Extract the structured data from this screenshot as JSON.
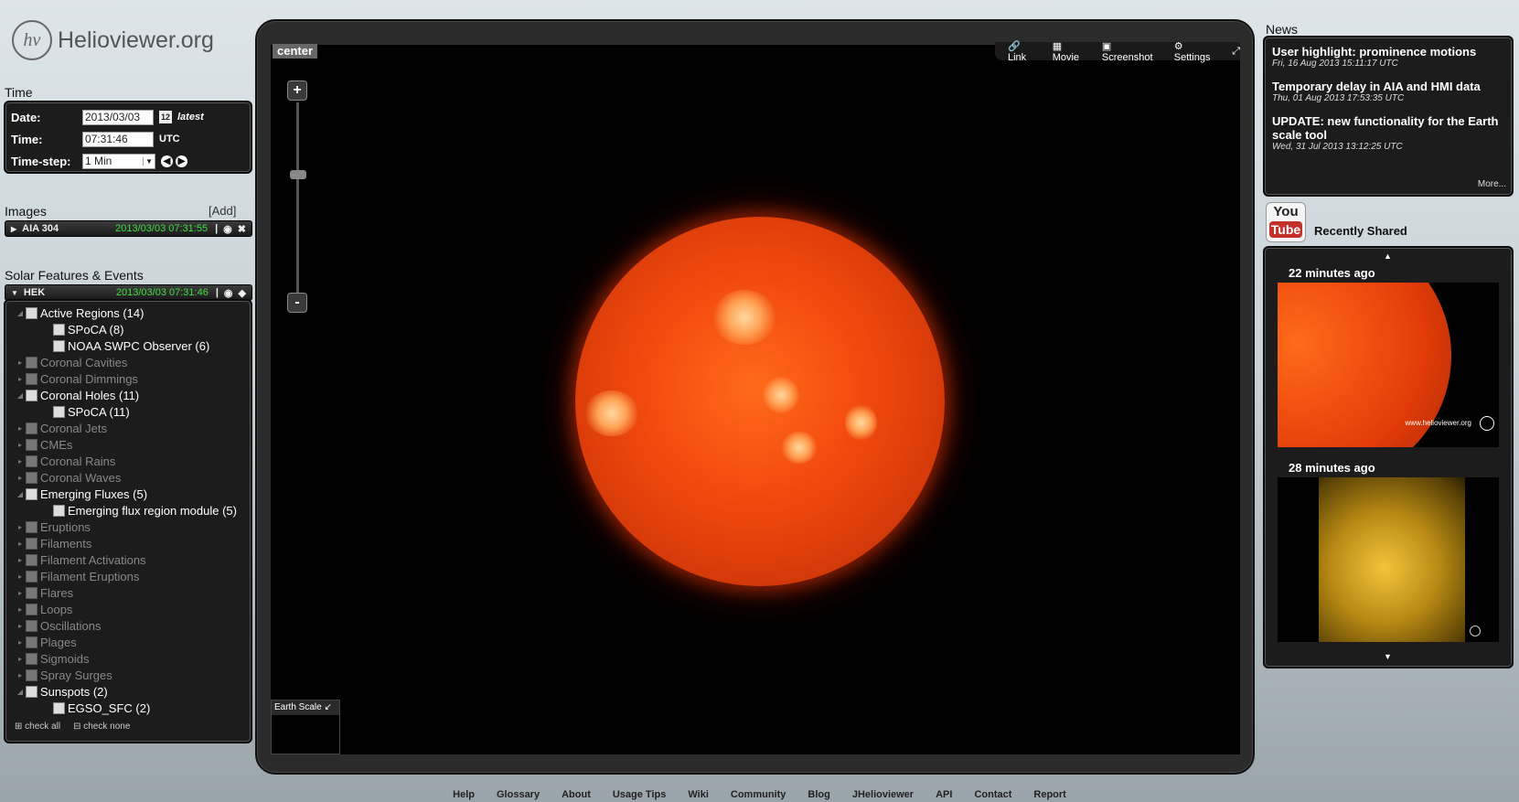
{
  "logo": {
    "mark": "hv",
    "name": "Helioviewer.org"
  },
  "time": {
    "section": "Time",
    "date_label": "Date:",
    "date_value": "2013/03/03",
    "calendar": "12",
    "latest": "latest",
    "time_label": "Time:",
    "time_value": "07:31:46",
    "utc": "UTC",
    "step_label": "Time-step:",
    "step_value": "1 Min"
  },
  "images": {
    "section": "Images",
    "add": "[Add]",
    "layer_name": "AIA 304",
    "layer_time": "2013/03/03 07:31:55"
  },
  "features": {
    "section": "Solar Features & Events",
    "hek_name": "HEK",
    "hek_time": "2013/03/03 07:31:46",
    "items": [
      {
        "label": "Active Regions (14)",
        "enabled": true,
        "level": 0,
        "expand": true
      },
      {
        "label": "SPoCA (8)",
        "enabled": true,
        "level": 1
      },
      {
        "label": "NOAA SWPC Observer (6)",
        "enabled": true,
        "level": 1
      },
      {
        "label": "Coronal Cavities",
        "enabled": false,
        "level": 0
      },
      {
        "label": "Coronal Dimmings",
        "enabled": false,
        "level": 0
      },
      {
        "label": "Coronal Holes (11)",
        "enabled": true,
        "level": 0,
        "expand": true
      },
      {
        "label": "SPoCA (11)",
        "enabled": true,
        "level": 1
      },
      {
        "label": "Coronal Jets",
        "enabled": false,
        "level": 0
      },
      {
        "label": "CMEs",
        "enabled": false,
        "level": 0
      },
      {
        "label": "Coronal Rains",
        "enabled": false,
        "level": 0
      },
      {
        "label": "Coronal Waves",
        "enabled": false,
        "level": 0
      },
      {
        "label": "Emerging Fluxes (5)",
        "enabled": true,
        "level": 0,
        "expand": true
      },
      {
        "label": "Emerging flux region module (5)",
        "enabled": true,
        "level": 1
      },
      {
        "label": "Eruptions",
        "enabled": false,
        "level": 0
      },
      {
        "label": "Filaments",
        "enabled": false,
        "level": 0
      },
      {
        "label": "Filament Activations",
        "enabled": false,
        "level": 0
      },
      {
        "label": "Filament Eruptions",
        "enabled": false,
        "level": 0
      },
      {
        "label": "Flares",
        "enabled": false,
        "level": 0
      },
      {
        "label": "Loops",
        "enabled": false,
        "level": 0
      },
      {
        "label": "Oscillations",
        "enabled": false,
        "level": 0
      },
      {
        "label": "Plages",
        "enabled": false,
        "level": 0
      },
      {
        "label": "Sigmoids",
        "enabled": false,
        "level": 0
      },
      {
        "label": "Spray Surges",
        "enabled": false,
        "level": 0
      },
      {
        "label": "Sunspots (2)",
        "enabled": true,
        "level": 0,
        "expand": true
      },
      {
        "label": "EGSO_SFC (2)",
        "enabled": true,
        "level": 1
      }
    ],
    "check_all": "check all",
    "check_none": "check none"
  },
  "viewport": {
    "center": "center",
    "toolbar": {
      "link": "Link",
      "movie": "Movie",
      "screenshot": "Screenshot",
      "settings": "Settings"
    },
    "earth_scale": "Earth Scale"
  },
  "news": {
    "section": "News",
    "items": [
      {
        "title": "User highlight: prominence motions",
        "date": "Fri, 16 Aug 2013 15:11:17 UTC"
      },
      {
        "title": "Temporary delay in AIA and HMI data",
        "date": "Thu, 01 Aug 2013 17:53:35 UTC"
      },
      {
        "title": "UPDATE: new functionality for the Earth scale tool",
        "date": "Wed, 31 Jul 2013 13:12:25 UTC"
      }
    ],
    "more": "More..."
  },
  "shared": {
    "youtube_top": "You",
    "youtube_bottom": "Tube",
    "title": "Recently Shared",
    "items": [
      {
        "time": "22 minutes ago",
        "watermark": "www.helioviewer.org"
      },
      {
        "time": "28 minutes ago"
      }
    ]
  },
  "footer": [
    "Help",
    "Glossary",
    "About",
    "Usage Tips",
    "Wiki",
    "Community",
    "Blog",
    "JHelioviewer",
    "API",
    "Contact",
    "Report"
  ]
}
